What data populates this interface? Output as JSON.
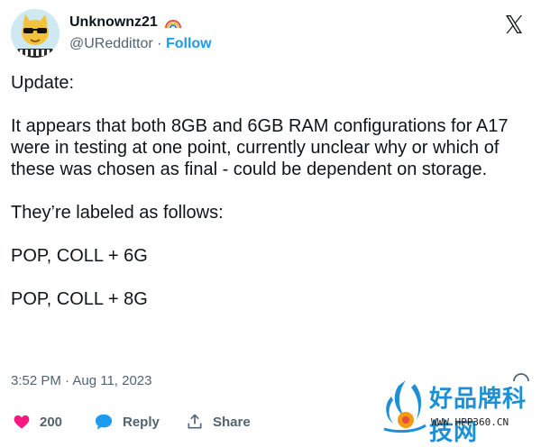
{
  "author": {
    "display_name": "Unknownz21",
    "handle": "@UReddittor",
    "separator": "·",
    "follow_label": "Follow"
  },
  "tweet": {
    "text": "Update:\n\nIt appears that both 8GB and 6GB RAM configurations for A17 were in testing at one point, currently unclear why or which of these was chosen as final - could be dependent on storage.\n\nThey’re labeled as follows:\n\nPOP, COLL + 6G\n\nPOP, COLL + 8G",
    "timestamp": "3:52 PM · Aug 11, 2023"
  },
  "actions": {
    "like_count": "200",
    "reply_label": "Reply",
    "share_label": "Share"
  },
  "watermark": {
    "brand": "好品牌科技网",
    "url": "WWW.HPP360.CN"
  },
  "colors": {
    "accent": "#1d9bf0",
    "like": "#f91880",
    "text": "#0f1419",
    "muted": "#536471",
    "watermark": "#1c8fd6"
  },
  "icons": [
    "avatar-cat",
    "rainbow-icon",
    "x-logo-icon",
    "info-icon",
    "heart-icon",
    "reply-bubble-icon",
    "share-icon",
    "watermark-logo"
  ]
}
